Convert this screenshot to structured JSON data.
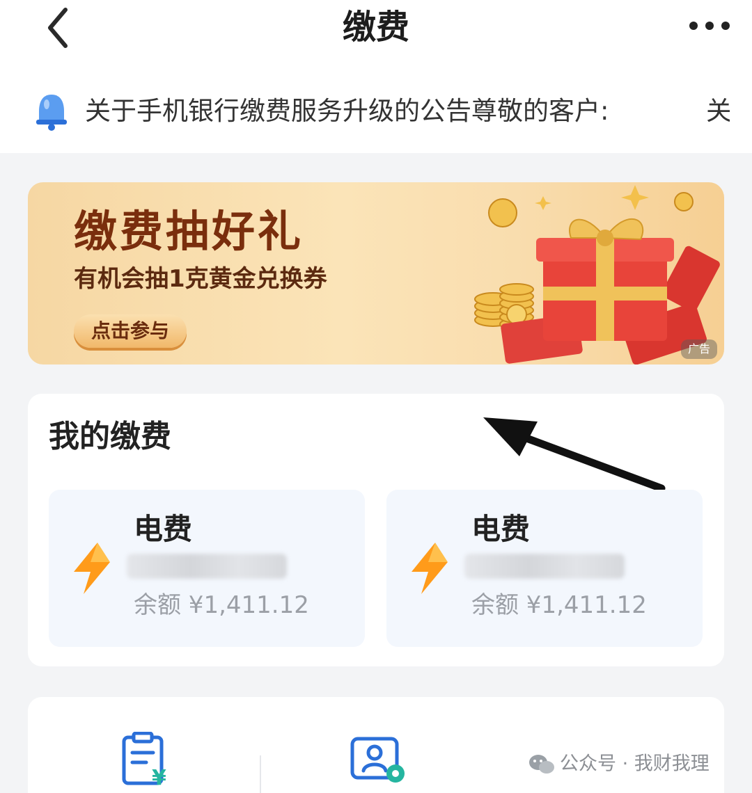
{
  "header": {
    "title": "缴费",
    "back_icon": "chevron-left-icon",
    "more_icon": "more-dots-icon"
  },
  "notice": {
    "icon": "bell-icon",
    "text": "关于手机银行缴费服务升级的公告尊敬的客户:",
    "text_next": "关"
  },
  "banner": {
    "headline": "缴费抽好礼",
    "subtitle": "有机会抽1克黄金兑换券",
    "cta_label": "点击参与",
    "ad_badge": "广告",
    "art": "gift-box-with-gold-coins-and-red-envelopes"
  },
  "my_bills": {
    "title": "我的缴费",
    "items": [
      {
        "name": "电费",
        "account": "",
        "balance": "余额 ¥1,411.12",
        "icon": "lightning-icon"
      },
      {
        "name": "电费",
        "account": "",
        "balance": "余额 ¥1,411.12",
        "icon": "lightning-icon"
      }
    ]
  },
  "tools": {
    "items": [
      {
        "icon": "bill-receipt-yen-icon"
      },
      {
        "icon": "account-settings-icon"
      }
    ]
  },
  "watermark": {
    "text": "公众号 · 我财我理",
    "icon": "wechat-icon"
  },
  "colors": {
    "accent_blue": "#2b6fd8",
    "lightning_orange": "#ff9b1a",
    "banner_brown": "#7a2e0d"
  }
}
